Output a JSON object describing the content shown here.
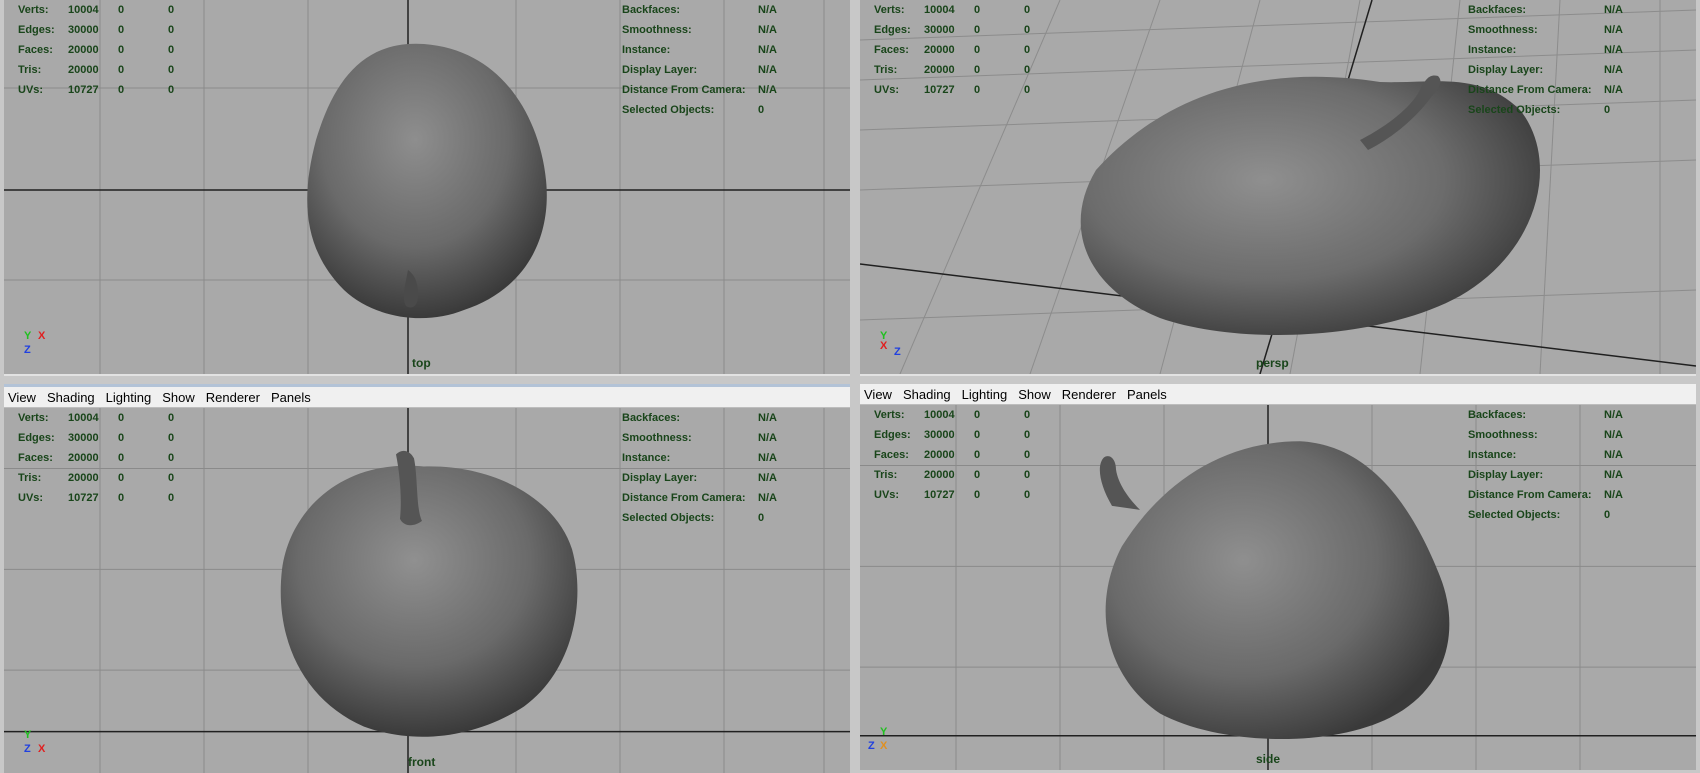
{
  "menu": [
    "View",
    "Shading",
    "Lighting",
    "Show",
    "Renderer",
    "Panels"
  ],
  "stats": [
    {
      "label": "Verts:",
      "values": [
        "10004",
        "0",
        "0"
      ]
    },
    {
      "label": "Edges:",
      "values": [
        "30000",
        "0",
        "0"
      ]
    },
    {
      "label": "Faces:",
      "values": [
        "20000",
        "0",
        "0"
      ]
    },
    {
      "label": "Tris:",
      "values": [
        "20000",
        "0",
        "0"
      ]
    },
    {
      "label": "UVs:",
      "values": [
        "10727",
        "0",
        "0"
      ]
    }
  ],
  "info": [
    {
      "label": "Backfaces:",
      "value": "N/A"
    },
    {
      "label": "Smoothness:",
      "value": "N/A"
    },
    {
      "label": "Instance:",
      "value": "N/A"
    },
    {
      "label": "Display Layer:",
      "value": "N/A"
    },
    {
      "label": "Distance From Camera:",
      "value": "N/A"
    },
    {
      "label": "Selected Objects:",
      "value": "0"
    }
  ],
  "panes": {
    "top": {
      "camera": "top",
      "axes": [
        "Y",
        "X",
        "Z"
      ]
    },
    "persp": {
      "camera": "persp",
      "axes": [
        "Y",
        "X",
        "Z"
      ]
    },
    "front": {
      "camera": "front",
      "axes": [
        "Y",
        "Z",
        "X"
      ]
    },
    "side": {
      "camera": "side",
      "axes": [
        "Y",
        "Z",
        "X"
      ]
    }
  },
  "colors": {
    "hud_text": "#19451a",
    "viewport_bg": "#a9a9a9",
    "grid": "#8a8a8a",
    "axis_x": "#e02020",
    "axis_y": "#20c020",
    "axis_z": "#2040e0"
  }
}
